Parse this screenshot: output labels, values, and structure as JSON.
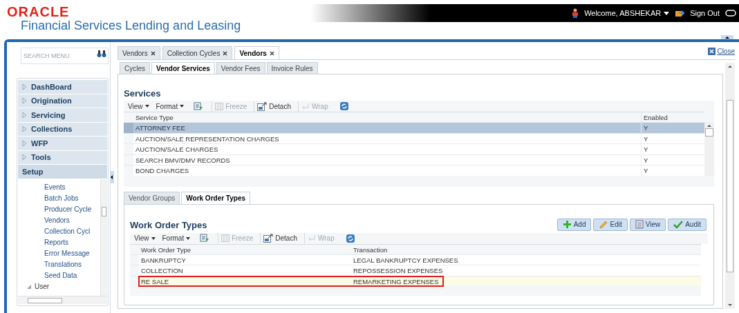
{
  "header": {
    "brand": "ORACLE",
    "product": "Financial Services Lending and Leasing",
    "welcome": "Welcome, ABSHEKAR",
    "sign_out": "Sign Out"
  },
  "search": {
    "placeholder": "SEARCH MENU"
  },
  "menu": [
    {
      "label": "DashBoard",
      "selected": false
    },
    {
      "label": "Origination",
      "selected": false
    },
    {
      "label": "Servicing",
      "selected": false
    },
    {
      "label": "Collections",
      "selected": false
    },
    {
      "label": "WFP",
      "selected": false
    },
    {
      "label": "Tools",
      "selected": false
    },
    {
      "label": "Setup",
      "selected": true
    }
  ],
  "submenu": [
    {
      "label": "Events"
    },
    {
      "label": "Batch Jobs"
    },
    {
      "label": "Producer Cycle"
    },
    {
      "label": "Vendors"
    },
    {
      "label": "Collection Cycl"
    },
    {
      "label": "Reports"
    },
    {
      "label": "Error Message"
    },
    {
      "label": "Translations"
    },
    {
      "label": "Seed Data"
    },
    {
      "label": "User",
      "expanded": true,
      "kind": "folder"
    }
  ],
  "tabs": [
    {
      "label": "Vendors",
      "selected": false
    },
    {
      "label": "Collection Cycles",
      "selected": false
    },
    {
      "label": "Vendors",
      "selected": true
    }
  ],
  "close": "Close",
  "subtabs": [
    {
      "label": "Cycles",
      "selected": false
    },
    {
      "label": "Vendor Services",
      "selected": true
    },
    {
      "label": "Vendor Fees",
      "selected": false
    },
    {
      "label": "Invoice Rules",
      "selected": false
    }
  ],
  "services": {
    "title": "Services",
    "toolbar": [
      {
        "label": "View",
        "kind": "menu"
      },
      {
        "label": "Format",
        "kind": "menu"
      },
      {
        "kind": "filter"
      },
      {
        "label": "Freeze",
        "kind": "freeze",
        "disabled": true
      },
      {
        "label": "Detach",
        "kind": "detach",
        "disabled": false
      },
      {
        "label": "Wrap",
        "kind": "wrap",
        "disabled": true
      },
      {
        "kind": "refresh"
      }
    ],
    "columns": [
      "Service Type",
      "Enabled"
    ],
    "rows": [
      {
        "cells": [
          "ATTORNEY FEE",
          "Y"
        ],
        "selected": true
      },
      {
        "cells": [
          "AUCTION/SALE REPRESENTATION CHARGES",
          "Y"
        ],
        "selected": false
      },
      {
        "cells": [
          "AUCTION/SALE CHARGES",
          "Y"
        ],
        "selected": false
      },
      {
        "cells": [
          "SEARCH BMV/DMV RECORDS",
          "Y"
        ],
        "selected": false
      },
      {
        "cells": [
          "BOND CHARGES",
          "Y"
        ],
        "selected": false
      }
    ]
  },
  "lower_tabs": [
    {
      "label": "Vendor Groups",
      "selected": false
    },
    {
      "label": "Work Order Types",
      "selected": true
    }
  ],
  "work_order_types": {
    "title": "Work Order Types",
    "actions": [
      {
        "label": "Add",
        "kind": "add"
      },
      {
        "label": "Edit",
        "kind": "edit"
      },
      {
        "label": "View",
        "kind": "view"
      },
      {
        "label": "Audit",
        "kind": "audit"
      }
    ],
    "toolbar": [
      {
        "label": "View",
        "kind": "menu"
      },
      {
        "label": "Format",
        "kind": "menu"
      },
      {
        "kind": "filter"
      },
      {
        "label": "Freeze",
        "kind": "freeze",
        "disabled": true
      },
      {
        "label": "Detach",
        "kind": "detach",
        "disabled": false
      },
      {
        "label": "Wrap",
        "kind": "wrap",
        "disabled": true
      },
      {
        "kind": "refresh"
      }
    ],
    "columns": [
      "Work Order Type",
      "Transaction"
    ],
    "rows": [
      {
        "cells": [
          "BANKRUPTCY",
          "LEGAL BANKRUPTCY EXPENSES"
        ],
        "selected": false,
        "highlighted": false
      },
      {
        "cells": [
          "COLLECTION",
          "REPOSSESSION EXPENSES"
        ],
        "selected": false,
        "highlighted": false
      },
      {
        "cells": [
          "RE SALE",
          "REMARKETING EXPENSES"
        ],
        "selected": true,
        "highlighted": true
      }
    ]
  }
}
